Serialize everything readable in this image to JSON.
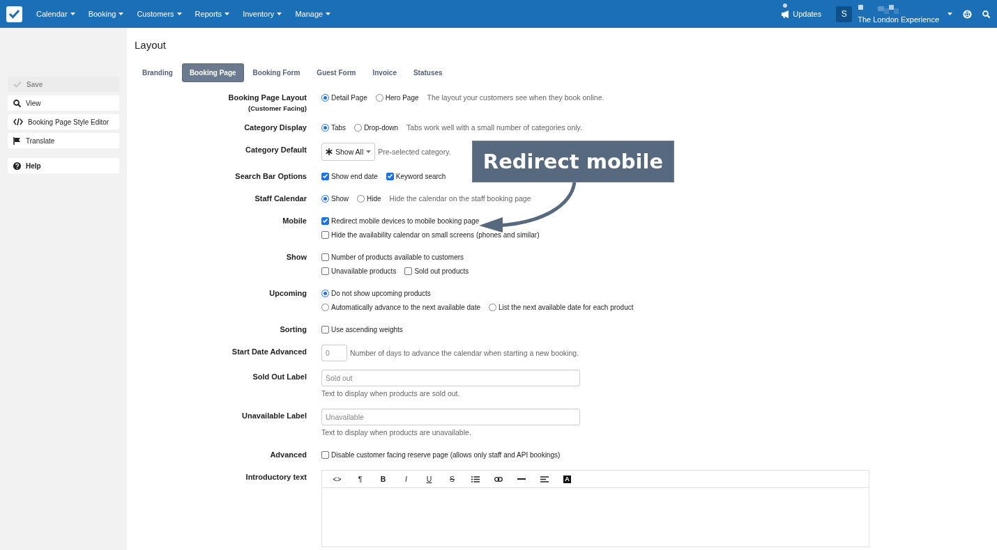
{
  "topbar": {
    "menus": [
      {
        "label": "Calendar"
      },
      {
        "label": "Booking"
      },
      {
        "label": "Customers"
      },
      {
        "label": "Reports"
      },
      {
        "label": "Inventory"
      },
      {
        "label": "Manage"
      }
    ],
    "updates": {
      "label": "Updates",
      "unread": true
    },
    "account": {
      "initial": "S",
      "name": "The London Experience"
    }
  },
  "sidebar": {
    "actions": [
      {
        "label": "Save",
        "disabled": true
      },
      {
        "label": "View",
        "disabled": false
      },
      {
        "label": "Booking Page Style Editor",
        "disabled": false
      },
      {
        "label": "Translate",
        "disabled": false
      }
    ],
    "help": {
      "label": "Help"
    }
  },
  "page": {
    "title": "Layout"
  },
  "tabs": [
    {
      "label": "Branding",
      "selected": false
    },
    {
      "label": "Booking Page",
      "selected": true
    },
    {
      "label": "Booking Form",
      "selected": false
    },
    {
      "label": "Guest Form",
      "selected": false
    },
    {
      "label": "Invoice",
      "selected": false
    },
    {
      "label": "Statuses",
      "selected": false
    }
  ],
  "settings": [
    {
      "label": "Booking Page Layout",
      "sublabel": "(Customer Facing)",
      "lines": [
        [
          {
            "kind": "radio",
            "label": "Detail Page",
            "selected": true
          },
          {
            "kind": "radio",
            "label": "Hero Page",
            "selected": false
          },
          {
            "kind": "help",
            "text": "The layout your customers see when they book online."
          }
        ]
      ]
    },
    {
      "label": "Category Display",
      "lines": [
        [
          {
            "kind": "radio",
            "label": "Tabs",
            "selected": true
          },
          {
            "kind": "radio",
            "label": "Drop-down",
            "selected": false
          },
          {
            "kind": "help",
            "text": "Tabs work well with a small number of categories only."
          }
        ]
      ]
    },
    {
      "label": "Category Default",
      "lines": [
        [
          {
            "kind": "select",
            "value": "Show All"
          },
          {
            "kind": "help",
            "text": "Pre-selected category."
          }
        ]
      ]
    },
    {
      "label": "Search Bar Options",
      "lines": [
        [
          {
            "kind": "checkbox",
            "label": "Show end date",
            "checked": true
          },
          {
            "kind": "checkbox",
            "label": "Keyword search",
            "checked": true
          }
        ]
      ]
    },
    {
      "label": "Staff Calendar",
      "lines": [
        [
          {
            "kind": "radio",
            "label": "Show",
            "selected": true
          },
          {
            "kind": "radio",
            "label": "Hide",
            "selected": false
          },
          {
            "kind": "help",
            "text": "Hide the calendar on the staff booking page"
          }
        ]
      ]
    },
    {
      "label": "Mobile",
      "lines": [
        [
          {
            "kind": "checkbox",
            "label": "Redirect mobile devices to mobile booking page",
            "checked": true
          }
        ],
        [
          {
            "kind": "checkbox",
            "label": "Hide the availability calendar on small screens (phones and similar)",
            "checked": false
          }
        ]
      ]
    },
    {
      "label": "Show",
      "lines": [
        [
          {
            "kind": "checkbox",
            "label": "Number of products available to customers",
            "checked": false
          }
        ],
        [
          {
            "kind": "checkbox",
            "label": "Unavailable products",
            "checked": false
          },
          {
            "kind": "checkbox",
            "label": "Sold out products",
            "checked": false
          }
        ]
      ]
    },
    {
      "label": "Upcoming",
      "lines": [
        [
          {
            "kind": "radio",
            "label": "Do not show upcoming products",
            "selected": true
          }
        ],
        [
          {
            "kind": "radio",
            "label": "Automatically advance to the next available date",
            "selected": false
          },
          {
            "kind": "radio",
            "label": "List the next available date for each product",
            "selected": false
          }
        ]
      ]
    },
    {
      "label": "Sorting",
      "lines": [
        [
          {
            "kind": "checkbox",
            "label": "Use ascending weights",
            "checked": false
          }
        ]
      ]
    },
    {
      "label": "Start Date Advanced",
      "lines": [
        [
          {
            "kind": "number",
            "placeholder": "0"
          },
          {
            "kind": "help",
            "text": "Number of days to advance the calendar when starting a new booking."
          }
        ]
      ]
    },
    {
      "label": "Sold Out Label",
      "lines": [
        [
          {
            "kind": "text",
            "placeholder": "Sold out"
          }
        ],
        [
          {
            "kind": "help",
            "text": "Text to display when products are sold out."
          }
        ]
      ]
    },
    {
      "label": "Unavailable Label",
      "lines": [
        [
          {
            "kind": "text",
            "placeholder": "Unavailable"
          }
        ],
        [
          {
            "kind": "help",
            "text": "Text to display when products are unavailable."
          }
        ]
      ]
    },
    {
      "label": "Advanced",
      "lines": [
        [
          {
            "kind": "checkbox",
            "label": "Disable customer facing reserve page (allows only staff and API bookings)",
            "checked": false
          }
        ]
      ]
    },
    {
      "label": "Introductory text",
      "lines": [
        [
          {
            "kind": "editor",
            "tools": [
              {
                "kind": "code",
                "label": "<>"
              },
              {
                "kind": "paragraph",
                "label": "¶"
              },
              {
                "kind": "bold",
                "label": "B"
              },
              {
                "kind": "italic",
                "label": "I"
              },
              {
                "kind": "underline",
                "label": "U"
              },
              {
                "kind": "strike",
                "label": "S"
              },
              {
                "kind": "list"
              },
              {
                "kind": "link"
              },
              {
                "kind": "rule"
              },
              {
                "kind": "align"
              },
              {
                "kind": "color",
                "label": "A"
              }
            ]
          }
        ]
      ]
    }
  ],
  "callout": {
    "text": "Redirect mobile"
  }
}
